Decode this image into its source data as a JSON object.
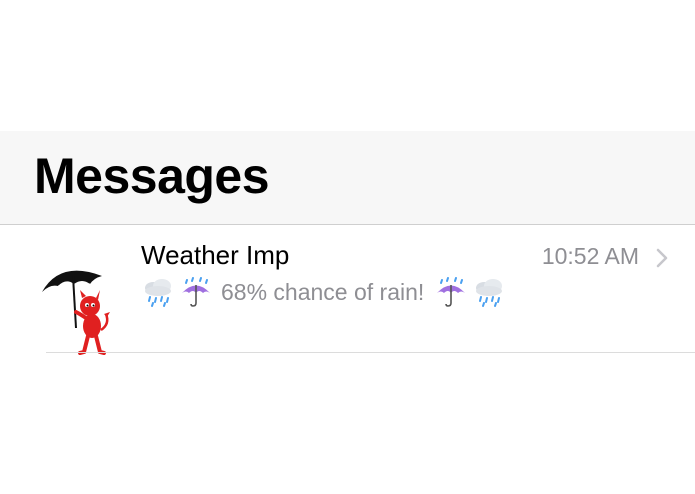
{
  "header": {
    "title": "Messages"
  },
  "conversation": {
    "sender": "Weather Imp",
    "timestamp": "10:52 AM",
    "preview_text": "68% chance of rain!",
    "preview_emojis_before": [
      "rain-cloud-icon",
      "umbrella-with-rain-icon"
    ],
    "preview_emojis_after": [
      "umbrella-with-rain-icon",
      "rain-cloud-icon"
    ],
    "avatar_icon": "imp-with-umbrella-icon"
  },
  "colors": {
    "header_background": "#f7f7f7",
    "secondary_text": "#8e8e93",
    "primary_text": "#000000",
    "avatar_red": "#e02020",
    "umbrella_purple": "#a070e0",
    "rain_blue": "#4aa0f0"
  }
}
